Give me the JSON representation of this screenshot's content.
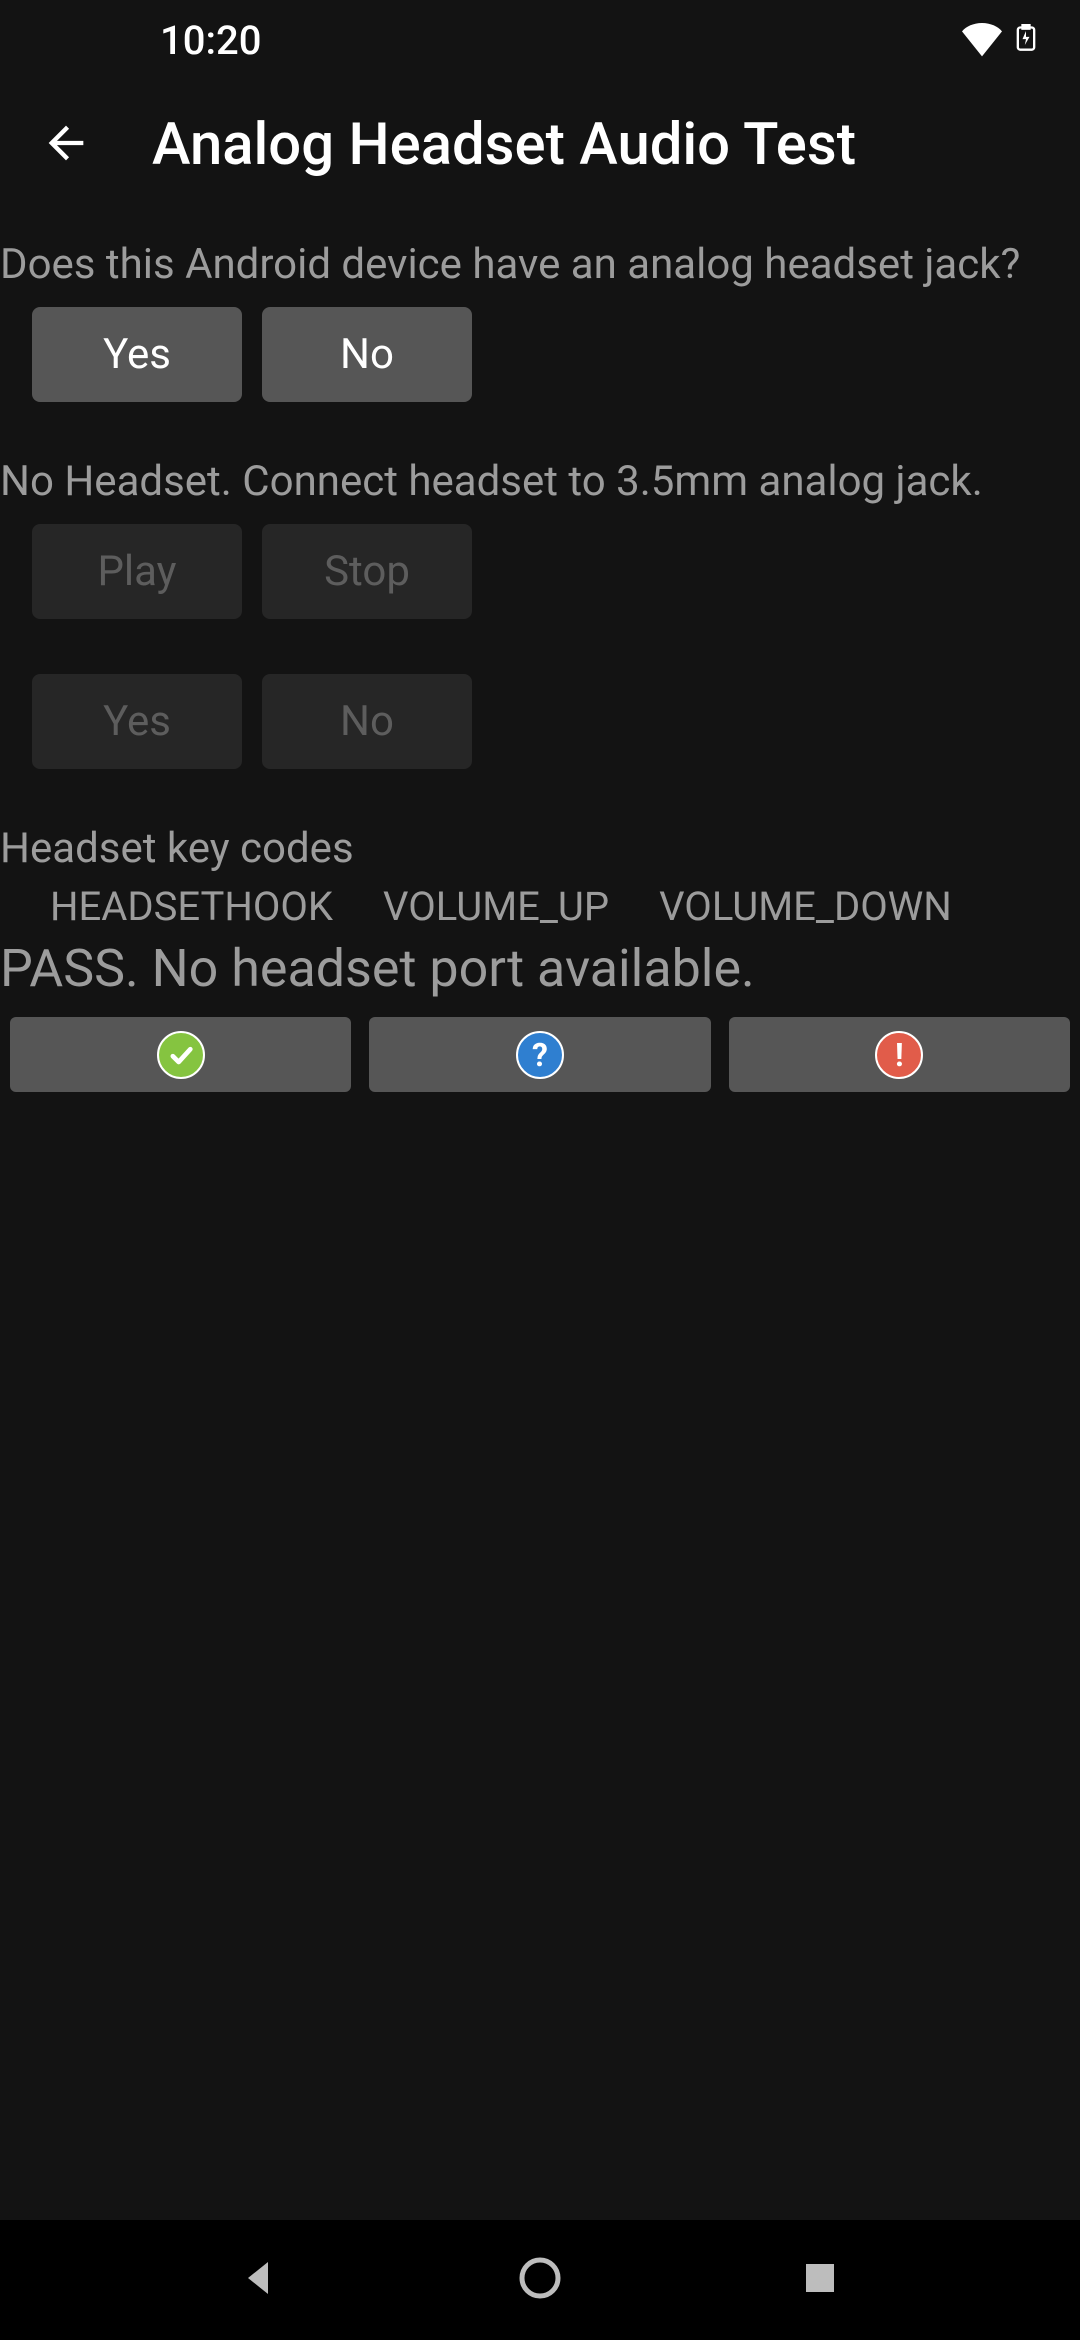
{
  "status_bar": {
    "time": "10:20"
  },
  "app_bar": {
    "title": "Analog Headset Audio Test"
  },
  "main": {
    "question": "Does this Android device have an analog headset jack?",
    "q_yes": "Yes",
    "q_no": "No",
    "instruction": "No Headset. Connect headset to 3.5mm analog jack.",
    "play": "Play",
    "stop": "Stop",
    "confirm_yes": "Yes",
    "confirm_no": "No",
    "section_label": "Headset key codes",
    "keycodes": {
      "hook": "HEADSETHOOK",
      "vol_up": "VOLUME_UP",
      "vol_down": "VOLUME_DOWN"
    },
    "result": "PASS. No headset port available."
  }
}
